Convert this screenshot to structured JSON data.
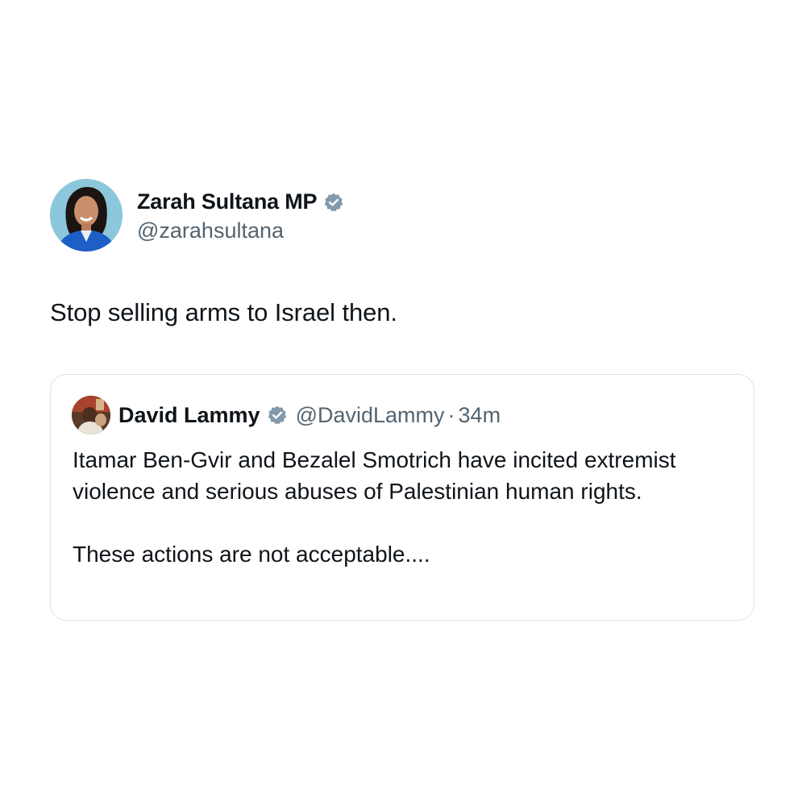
{
  "tweet": {
    "author": {
      "display_name": "Zarah Sultana MP",
      "handle": "@zarahsultana",
      "verified_icon": "verified-badge-icon"
    },
    "text": "Stop selling arms to Israel then."
  },
  "quoted_tweet": {
    "author": {
      "display_name": "David Lammy",
      "handle": "@DavidLammy",
      "verified_icon": "verified-badge-icon"
    },
    "separator": "·",
    "timestamp": "34m",
    "paragraphs": [
      "Itamar Ben-Gvir and Bezalel Smotrich have incited extremist violence and serious abuses of Palestinian human rights.",
      "These actions are not acceptable...."
    ]
  },
  "colors": {
    "text_primary": "#0f1419",
    "text_secondary": "#536471",
    "badge_gray": "#829aab",
    "card_border": "#dfe3e6"
  }
}
